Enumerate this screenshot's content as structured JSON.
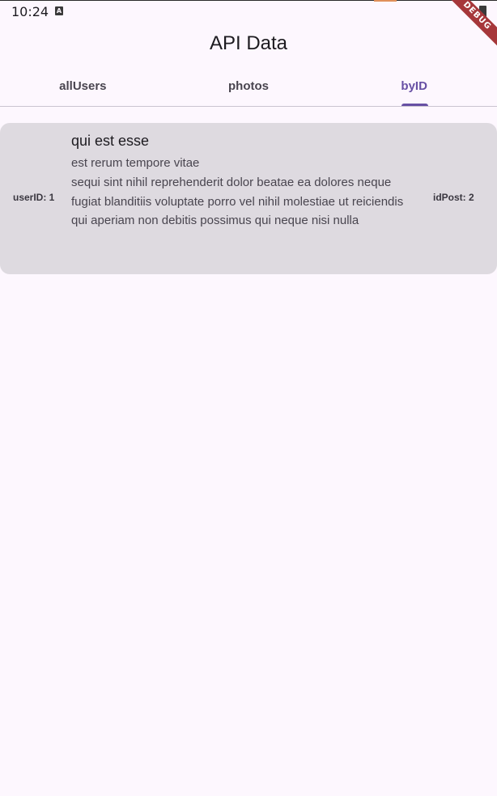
{
  "status_bar": {
    "time": "10:24",
    "a_icon": "A",
    "debug": "DEBUG"
  },
  "app_bar": {
    "title": "API Data"
  },
  "tabs": [
    {
      "label": "allUsers",
      "selected": false
    },
    {
      "label": "photos",
      "selected": false
    },
    {
      "label": "byID",
      "selected": true
    }
  ],
  "post": {
    "user_label": "userID: 1",
    "id_label": "idPost: 2",
    "title": "qui est esse",
    "body": "est rerum tempore vitae\nsequi sint nihil reprehenderit dolor beatae ea dolores neque\nfugiat blanditiis voluptate porro vel nihil molestiae ut reiciendis\nqui aperiam non debitis possimus qui neque nisi nulla"
  },
  "colors": {
    "background": "#fdf7fe",
    "accent": "#6750a4",
    "card": "#dedae0",
    "debug_banner": "#a6373a"
  }
}
